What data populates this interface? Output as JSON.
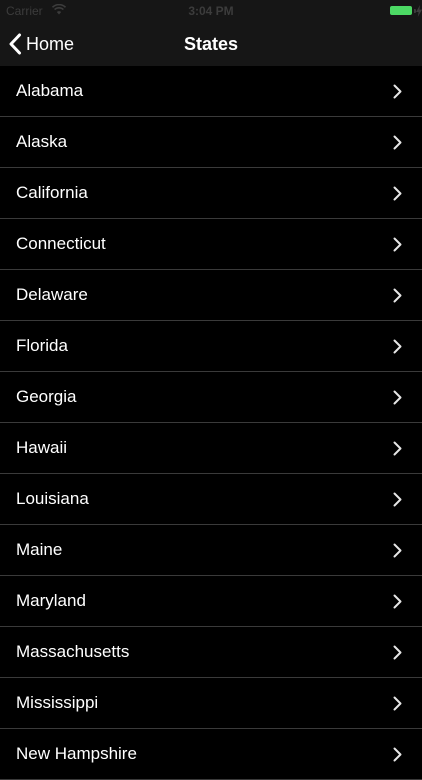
{
  "status_bar": {
    "carrier": "Carrier",
    "time": "3:04 PM",
    "battery_color": "#4cd964"
  },
  "nav": {
    "back_label": "Home",
    "title": "States"
  },
  "states": [
    "Alabama",
    "Alaska",
    "California",
    "Connecticut",
    "Delaware",
    "Florida",
    "Georgia",
    "Hawaii",
    "Louisiana",
    "Maine",
    "Maryland",
    "Massachusetts",
    "Mississippi",
    "New Hampshire"
  ],
  "icons": {
    "back": "chevron-left-icon",
    "row": "chevron-right-icon",
    "wifi": "wifi-icon",
    "battery": "battery-icon"
  }
}
